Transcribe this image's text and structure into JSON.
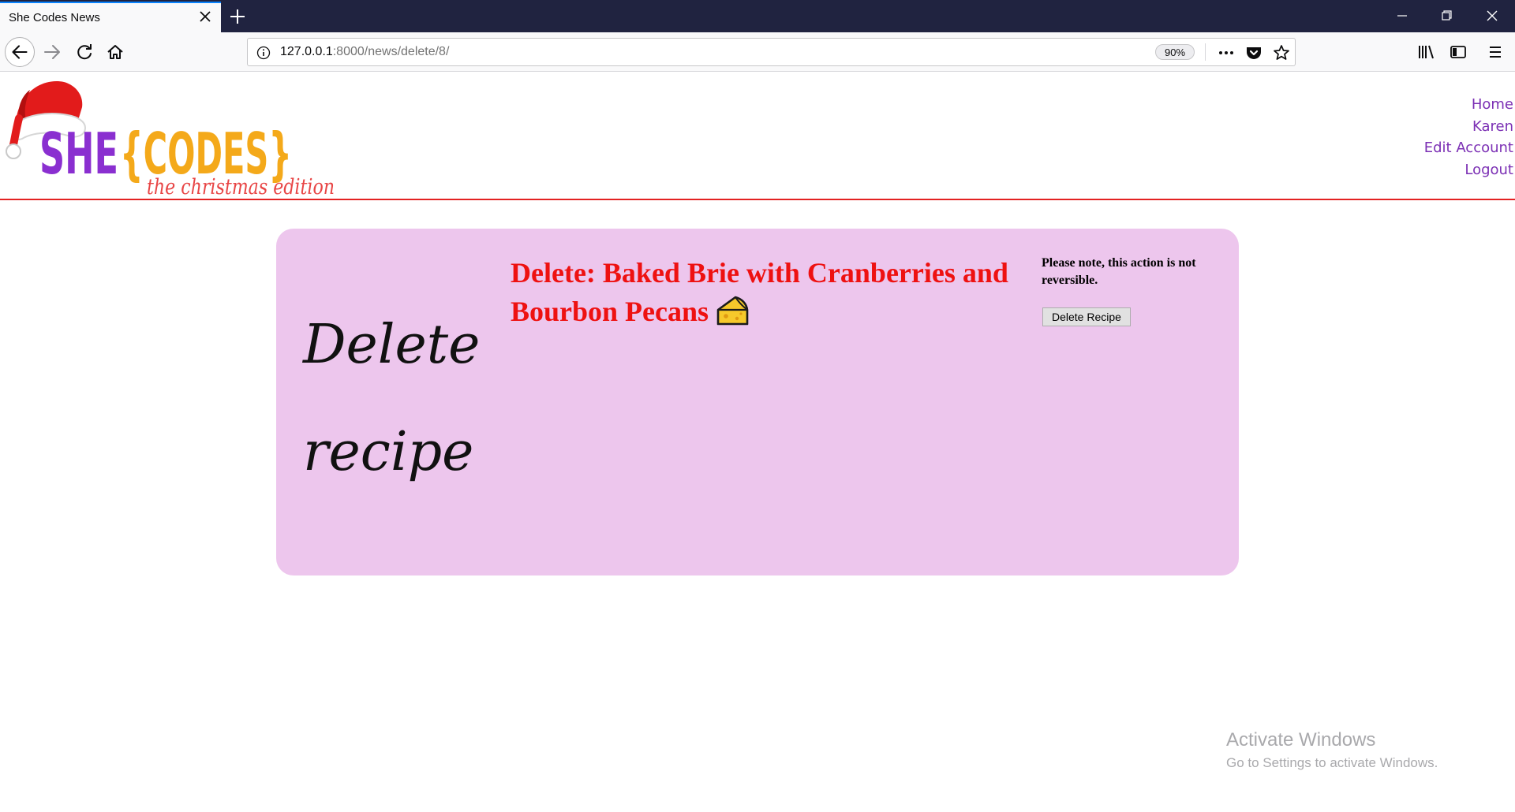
{
  "browser": {
    "tab_title": "She Codes News",
    "url_host": "127.0.0.1",
    "url_path": ":8000/news/delete/8/",
    "zoom": "90%"
  },
  "site": {
    "logo_alt": "SHE{CODES} the christmas edition",
    "nav": [
      "Home",
      "Karen",
      "Edit Account",
      "Logout"
    ]
  },
  "card": {
    "heading_line1": "Delete",
    "heading_line2": "recipe",
    "title": "Delete: Baked Brie with Cranberries and Bourbon Pecans",
    "notice": "Please note, this action is not reversible.",
    "delete_button": "Delete Recipe"
  },
  "overlay": {
    "activate_title": "Activate Windows",
    "activate_sub": "Go to Settings to activate Windows."
  },
  "colors": {
    "card_bg": "#edc6ed",
    "title_red": "#ee1111",
    "nav_purple": "#7b2fb4",
    "header_rule": "#e32222"
  }
}
